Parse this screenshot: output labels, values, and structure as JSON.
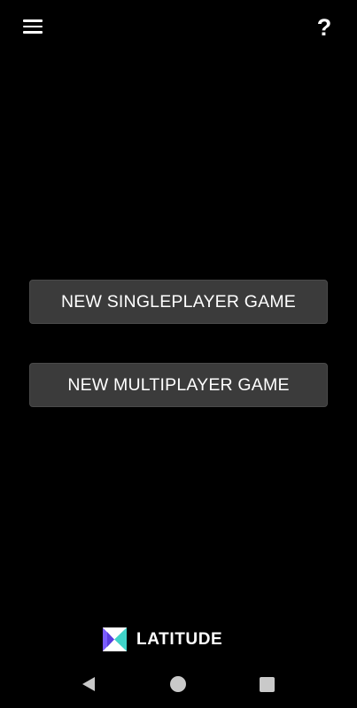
{
  "header": {
    "menu_icon": "hamburger-menu-icon",
    "help_label": "?"
  },
  "main": {
    "singleplayer_label": "NEW SINGLEPLAYER GAME",
    "multiplayer_label": "NEW MULTIPLAYER GAME"
  },
  "footer": {
    "brand_name": "LATITUDE",
    "brand_logo": "latitude-logo"
  },
  "system_nav": {
    "back_icon": "back-triangle-icon",
    "home_icon": "home-circle-icon",
    "recents_icon": "recents-square-icon"
  },
  "colors": {
    "background": "#000000",
    "button_background": "#3b3b3b",
    "text": "#ffffff",
    "nav_icon": "#c9c9c9",
    "logo_purple": "#7a5cff",
    "logo_teal": "#3fd3c8"
  }
}
